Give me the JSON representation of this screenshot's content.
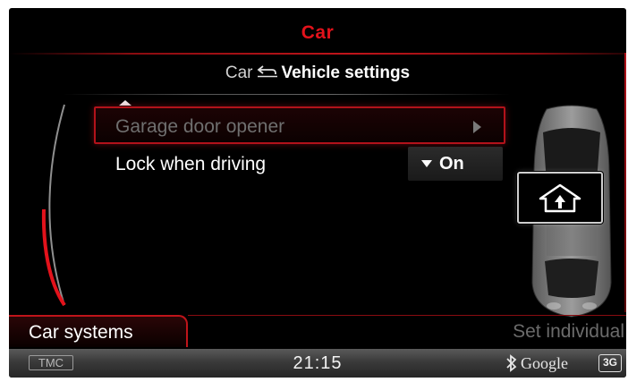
{
  "header": {
    "title": "Car"
  },
  "breadcrumb": {
    "parent": "Car",
    "current": "Vehicle settings"
  },
  "menu": {
    "items": [
      {
        "label": "Garage door opener",
        "state": "selected, dimmed"
      },
      {
        "label": "Lock when driving",
        "value": "On"
      }
    ]
  },
  "tabs": {
    "left": "Car systems",
    "right": "Set individual"
  },
  "status_bar": {
    "tmc": "TMC",
    "time": "21:15",
    "provider": "Google",
    "network": "3G"
  },
  "icons": {
    "back": "back-arrow-icon",
    "next": "chevron-right-icon",
    "dropdown": "triangle-down-icon",
    "home": "home-icon",
    "bluetooth": "bluetooth-icon"
  },
  "colors": {
    "accent": "#e3121b",
    "background": "#000000",
    "text": "#ffffff",
    "dimmed": "#6f6f6f"
  }
}
